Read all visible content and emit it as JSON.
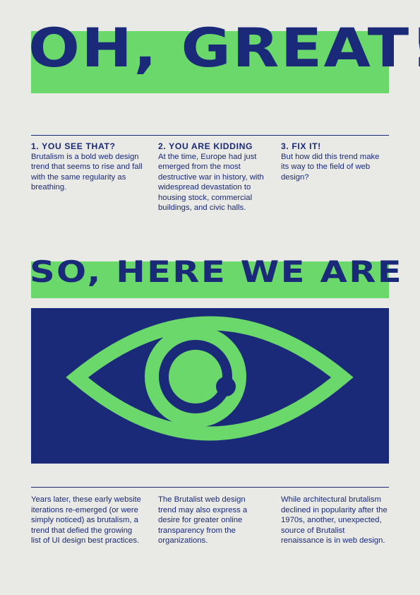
{
  "hero": {
    "title": "OH, GREAT!"
  },
  "columns_top": [
    {
      "heading": "1.  YOU SEE THAT?",
      "text": "Brutalism is a bold web design trend that seems to rise and fall with the same regularity as breathing."
    },
    {
      "heading": "2. YOU ARE KIDDING",
      "text": "At the time, Europe had just emerged from the most destructive war in history, with widespread devastation to housing stock, commercial buildings, and civic halls."
    },
    {
      "heading": "3. FIX IT!",
      "text": "But how did this trend make its way to the field of web design?"
    }
  ],
  "section2": {
    "title": "SO, HERE WE ARE"
  },
  "eye": {
    "icon": "eye-icon",
    "color": "#6ad86b",
    "background": "#1b2a78"
  },
  "columns_bottom": [
    {
      "text": "Years later, these early website iterations re-emerged (or were simply noticed) as brutalism, a trend that defied the growing list of UI design best practices."
    },
    {
      "text": "The Brutalist web design trend may also express a desire for greater online transparency from the organizations."
    },
    {
      "text": "While architectural brutalism declined in popularity after the 1970s, another, unexpected, source of Brutalist renaissance is in web design."
    }
  ],
  "colors": {
    "navy": "#1b2a78",
    "green": "#6ad86b",
    "paper": "#e9e9e6"
  }
}
